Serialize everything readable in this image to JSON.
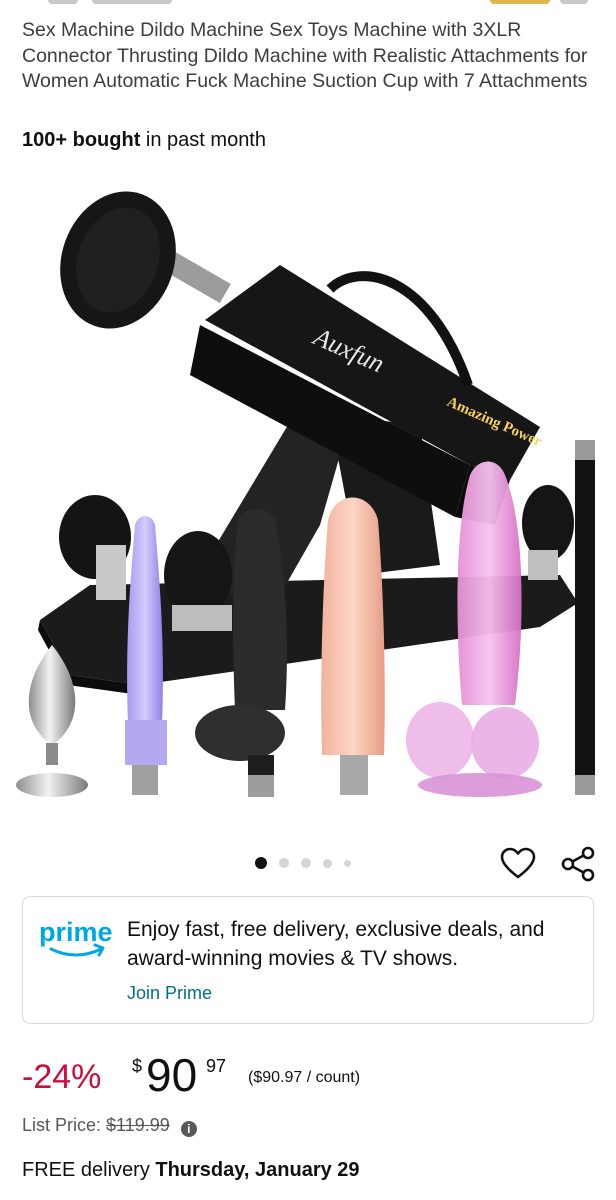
{
  "product": {
    "title": "Sex Machine Dildo Machine Sex Toys Machine with 3XLR Connector Thrusting Dildo Machine with Realistic Attachments for Women Automatic Fuck Machine Suction Cup with 7 Attachments",
    "bought_count": "100+ bought",
    "bought_suffix": "in past month",
    "image": {
      "brand_print": "Auxfun",
      "badge_print": "Amazing Power"
    },
    "carousel": {
      "total": 5,
      "active_index": 0
    }
  },
  "actions": {
    "wishlist_icon": "heart-icon",
    "share_icon": "share-icon"
  },
  "prime": {
    "logo_text": "prime",
    "message": "Enjoy fast, free delivery, exclusive deals, and award-winning movies & TV shows.",
    "join_label": "Join Prime",
    "accent_color": "#00a8e1",
    "link_color": "#007185"
  },
  "pricing": {
    "discount": "-24%",
    "currency_symbol": "$",
    "whole": "90",
    "fraction": "97",
    "unit_price": "($90.97 / count)",
    "list_price_label": "List Price:",
    "list_price": "$119.99",
    "discount_color": "#cc0c39"
  },
  "delivery": {
    "prefix": "FREE delivery",
    "date": "Thursday, January 29"
  }
}
